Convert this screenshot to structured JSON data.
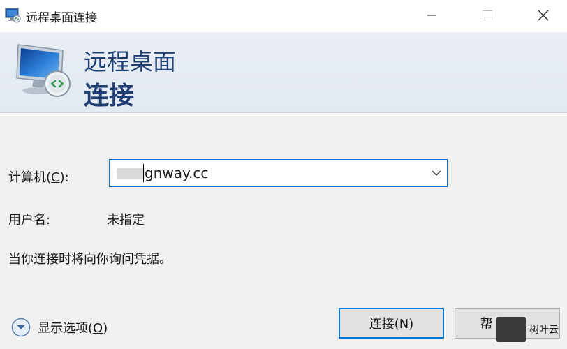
{
  "window": {
    "title": "远程桌面连接",
    "controls": {
      "minimize": "minimize-icon",
      "maximize": "maximize-icon",
      "close": "close-icon"
    }
  },
  "banner": {
    "line1": "远程桌面",
    "line2": "连接",
    "colors": {
      "text": "#1f3f73",
      "background": "#e6ecf3"
    }
  },
  "form": {
    "computer_label": "计算机(",
    "computer_mnemonic": "C",
    "computer_label_end": "):",
    "computer_value": "gnway.cc",
    "user_label": "用户名:",
    "user_value": "未指定",
    "credentials_note": "当你连接时将向你询问凭据。"
  },
  "footer": {
    "options_label": "显示选项(",
    "options_mnemonic": "O",
    "options_label_end": ")",
    "connect_label": "连接(",
    "connect_mnemonic": "N",
    "connect_label_end": ")",
    "help_label": "帮",
    "watermark_text": "树叶云"
  },
  "colors": {
    "accent": "#0078d7",
    "window_bg": "#f0f0f0"
  }
}
